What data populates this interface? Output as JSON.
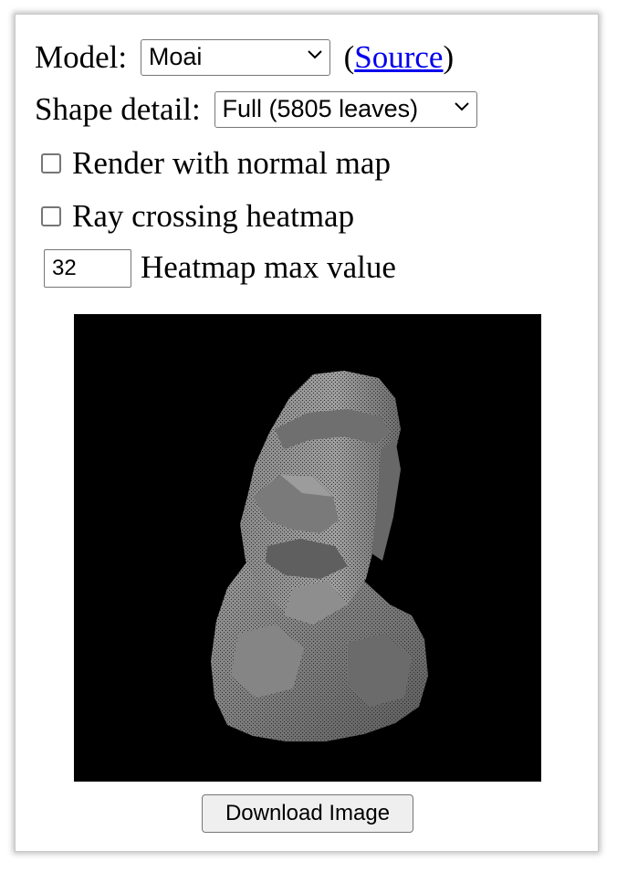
{
  "model": {
    "label": "Model:",
    "selected": "Moai",
    "source_open": "(",
    "source_link": "Source",
    "source_close": ")"
  },
  "detail": {
    "label": "Shape detail:",
    "selected": "Full (5805 leaves)"
  },
  "options": {
    "normal_map_label": "Render with normal map",
    "normal_map_checked": false,
    "heatmap_label": "Ray crossing heatmap",
    "heatmap_checked": false
  },
  "heatmap_max": {
    "value": "32",
    "label": "Heatmap max value"
  },
  "render": {
    "subject": "moai-statue"
  },
  "download_button": "Download Image"
}
